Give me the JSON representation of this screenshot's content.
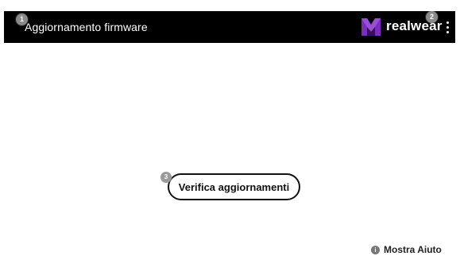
{
  "header": {
    "title": "Aggiornamento firmware",
    "brand": "realwear",
    "menu_icon": "more-vert-icon",
    "logo_icon": "realwear-logo-icon",
    "background": "#000000",
    "logo_color": "#7b2cbf"
  },
  "annotations": {
    "badge1": "1",
    "badge2": "2",
    "badge3": "3"
  },
  "main": {
    "check_button_label": "Verifica aggiornamenti"
  },
  "footer": {
    "help_label": "Mostra Aiuto",
    "help_icon_glyph": "i",
    "help_icon": "info-icon"
  }
}
